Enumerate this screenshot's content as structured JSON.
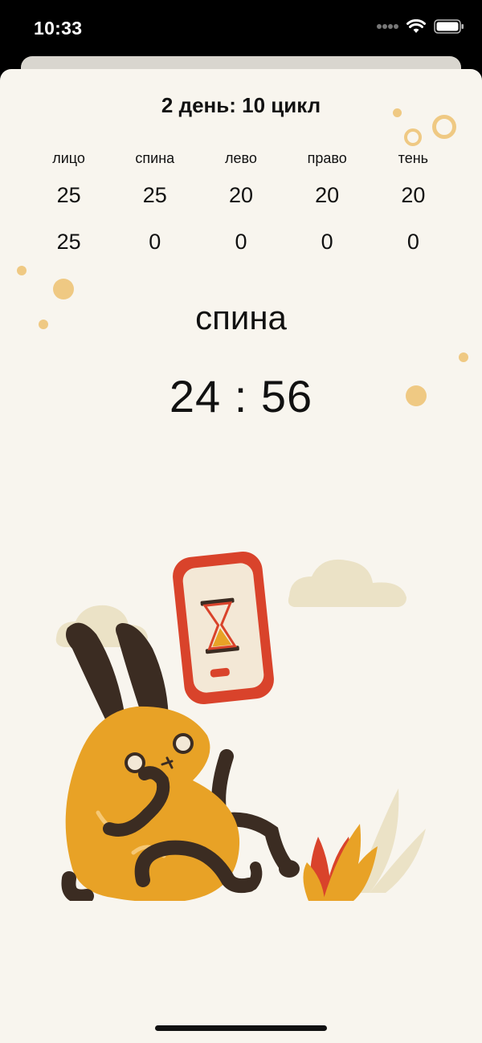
{
  "status_bar": {
    "time": "10:33",
    "icons": [
      "signal-dots-icon",
      "wifi-icon",
      "battery-icon"
    ]
  },
  "header": {
    "title": "2 день: 10 цикл"
  },
  "table": {
    "columns": [
      "лицо",
      "спина",
      "лево",
      "право",
      "тень"
    ],
    "targets": [
      "25",
      "25",
      "20",
      "20",
      "20"
    ],
    "done": [
      "25",
      "0",
      "0",
      "0",
      "0"
    ]
  },
  "current": {
    "exercise": "спина",
    "timer": "24 : 56"
  },
  "illustration": {
    "name": "rabbit-with-phone-hourglass-illustration"
  },
  "colors": {
    "background": "#f8f5ee",
    "accent": "#efc983",
    "rabbit": "#e8a226",
    "phone": "#d9432b"
  }
}
